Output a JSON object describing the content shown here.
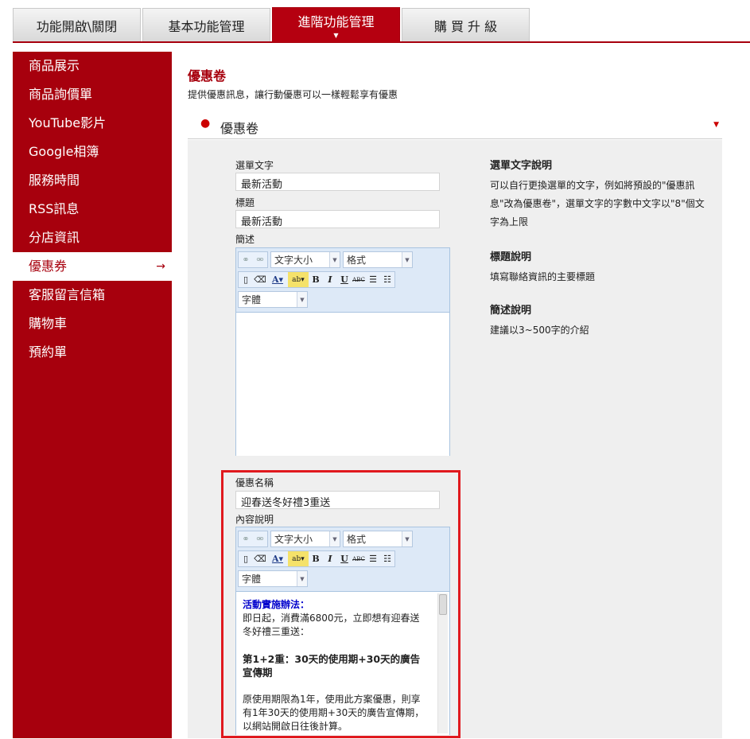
{
  "tabs": [
    {
      "label": "功能開啟\\關閉",
      "active": false
    },
    {
      "label": "基本功能管理",
      "active": false
    },
    {
      "label": "進階功能管理",
      "active": true
    },
    {
      "label": "購 買 升 級",
      "active": false
    }
  ],
  "sidebar": {
    "items": [
      {
        "label": "商品展示"
      },
      {
        "label": "商品詢價單"
      },
      {
        "label": "YouTube影片"
      },
      {
        "label": "Google相簿"
      },
      {
        "label": "服務時間"
      },
      {
        "label": "RSS訊息"
      },
      {
        "label": "分店資訊"
      },
      {
        "label": "優惠券",
        "active": true,
        "arrow": "→"
      },
      {
        "label": "客服留言信箱"
      },
      {
        "label": "購物車"
      },
      {
        "label": "預約單"
      }
    ]
  },
  "page": {
    "title": "優惠卷",
    "description": "提供優惠訊息，讓行動優惠可以一樣輕鬆享有優惠",
    "section_title": "優惠卷"
  },
  "form": {
    "menu_text_label": "選單文字",
    "menu_text_value": "最新活動",
    "title_label": "標題",
    "title_value": "最新活動",
    "summary_label": "簡述",
    "coupon_name_label": "優惠名稱",
    "coupon_name_value": "迎春送冬好禮3重送",
    "content_label": "內容說明"
  },
  "editor": {
    "font_size_select": "文字大小",
    "format_select": "格式",
    "font_select": "字體",
    "bold": "B",
    "italic": "I",
    "underline": "U",
    "strike": "ABC"
  },
  "content": {
    "heading": "活動實施辦法：",
    "para1": "即日起，消費滿6800元，立即想有迎春送冬好禮三重送：",
    "bold_line": "第1+2重：30天的使用期+30天的廣告宣傳期",
    "para2": "原使用期限為1年，使用此方案優惠，則享有1年30天的使用期+30天的廣告宣傳期，以網站開啟日往後計算。"
  },
  "help": [
    {
      "title": "選單文字說明",
      "text": "可以自行更換選單的文字，例如將預設的\"優惠訊息\"改為優惠卷\"，選單文字的字數中文字以\"8\"個文字為上限"
    },
    {
      "title": "標題說明",
      "text": "填寫聯絡資訊的主要標題"
    },
    {
      "title": "簡述說明",
      "text": "建議以3~500字的介紹"
    }
  ],
  "colors": {
    "accent": "#a7000d",
    "highlight": "#e0191e"
  }
}
